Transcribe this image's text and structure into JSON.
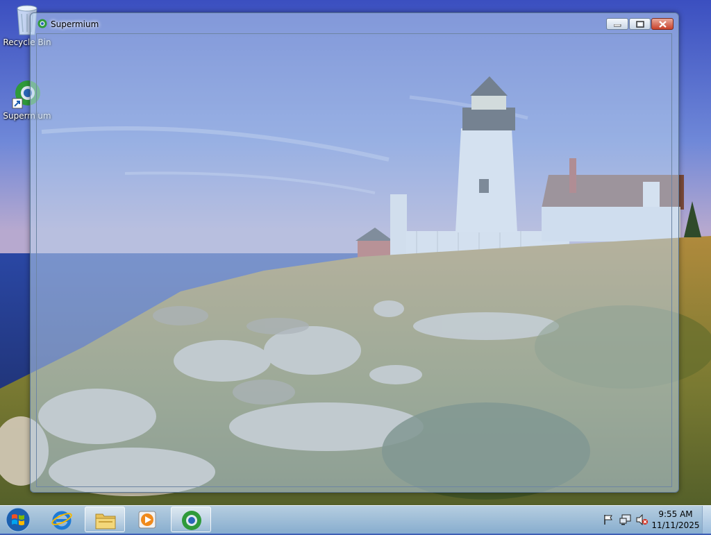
{
  "desktop": {
    "icons": [
      {
        "label": "Recycle Bin",
        "icon": "recycle-bin-icon"
      },
      {
        "label": "Supermium",
        "icon": "supermium-icon"
      }
    ]
  },
  "window": {
    "title": "Supermium",
    "icon": "supermium-icon",
    "controls": [
      "minimize-icon",
      "maximize-icon",
      "close-icon"
    ]
  },
  "taskbar": {
    "start_icon": "windows-start-icon",
    "pinned": [
      {
        "name": "internet-explorer-icon"
      },
      {
        "name": "file-explorer-icon"
      },
      {
        "name": "media-player-icon"
      },
      {
        "name": "supermium-icon"
      }
    ],
    "tray": [
      "action-center-flag-icon",
      "network-icon",
      "volume-muted-icon"
    ],
    "clock": {
      "time": "9:55 AM",
      "date": "11/11/2025"
    }
  },
  "colors": {
    "sky": "#4a66c4",
    "sea": "#2c4aa0",
    "grass": "#8a8a3a",
    "close_button": "#c8412a"
  }
}
